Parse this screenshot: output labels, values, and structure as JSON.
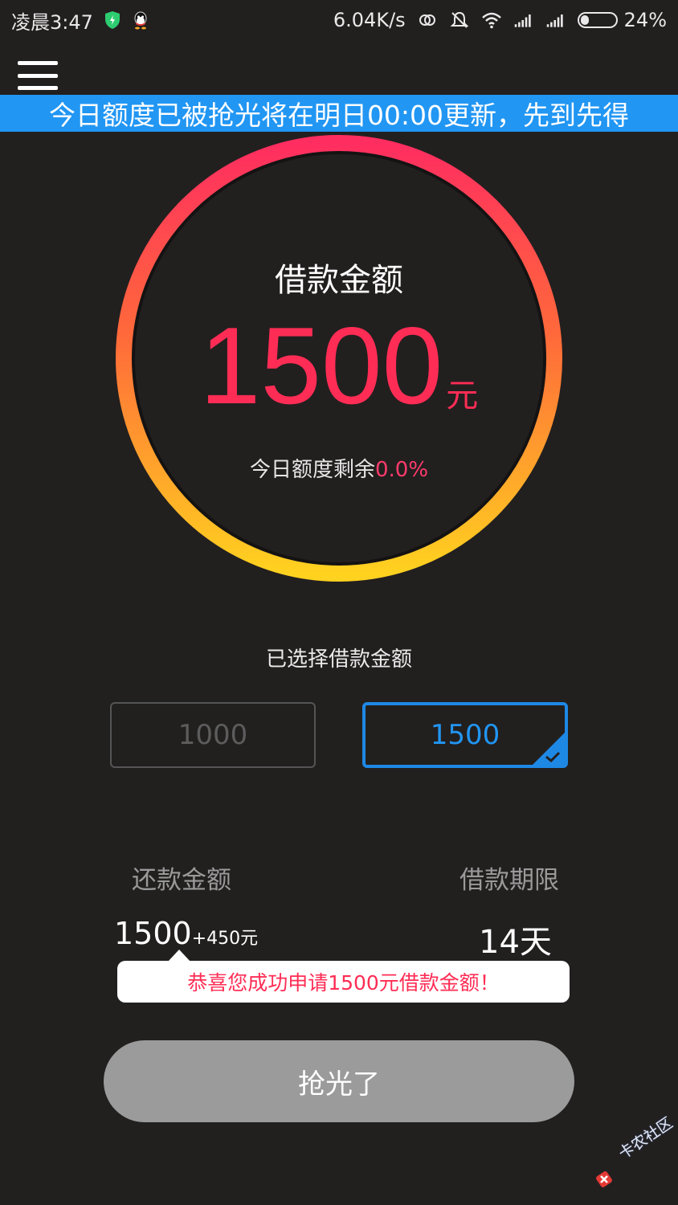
{
  "status_bar": {
    "time": "凌晨3:47",
    "network_speed": "6.04K/s",
    "battery": "24%",
    "battery_level": 0.24,
    "icons": [
      "shield-icon",
      "qq-icon",
      "sync-icon",
      "mute-bell-icon",
      "wifi-icon",
      "signal-icon",
      "signal-icon-2",
      "battery-icon"
    ]
  },
  "banner": {
    "text": "今日额度已被抢光将在明日00:00更新，先到先得"
  },
  "gauge": {
    "title": "借款金额",
    "amount": "1500",
    "unit": "元",
    "remaining_label": "今日额度剩余",
    "remaining_value": "0.0%",
    "colors": {
      "top": "#ff2d60",
      "middle": "#ff6a3a",
      "bottom": "#ffd21f"
    }
  },
  "selection": {
    "label": "已选择借款金额",
    "options": [
      {
        "value": "1000",
        "selected": false
      },
      {
        "value": "1500",
        "selected": true
      }
    ],
    "accent": "#1e88e5"
  },
  "repayment": {
    "label": "还款金额",
    "amount": "1500",
    "interest": "+450元"
  },
  "term": {
    "label": "借款期限",
    "value": "14天"
  },
  "tooltip": {
    "text": "恭喜您成功申请1500元借款金额！"
  },
  "action": {
    "label": "抢光了",
    "color": "#9b9b9b"
  },
  "watermark": {
    "text": "卡农社区"
  }
}
